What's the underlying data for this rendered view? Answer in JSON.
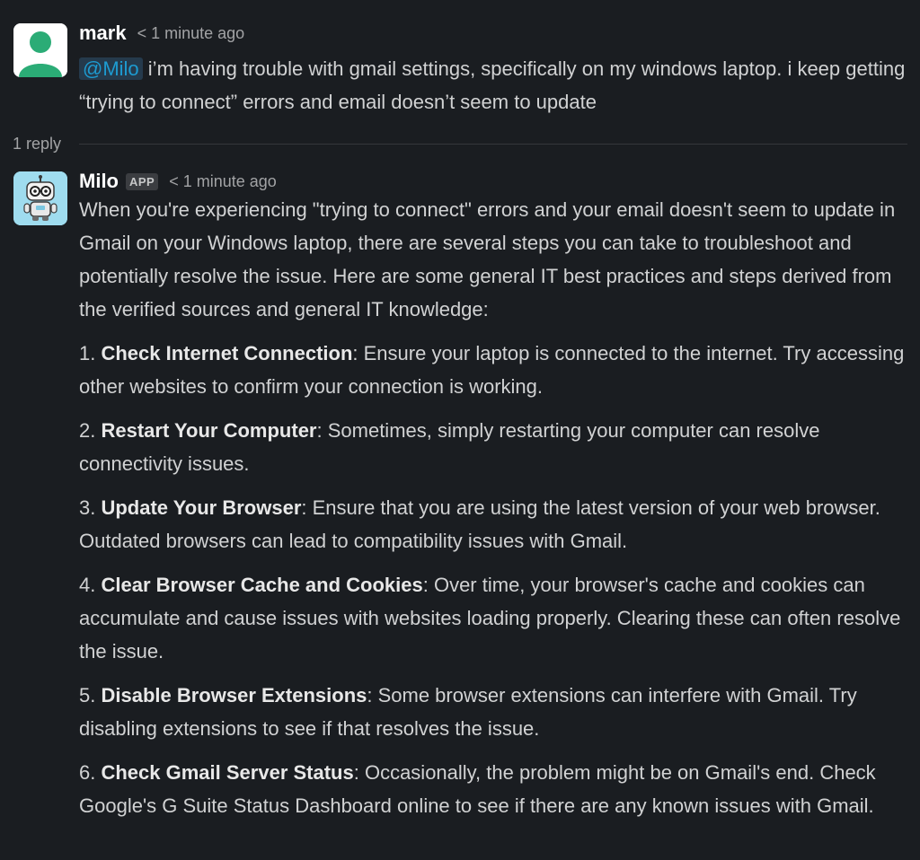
{
  "message1": {
    "author": "mark",
    "timestamp": "< 1 minute ago",
    "mention": "@Milo",
    "text": "i’m having trouble with gmail settings, specifically on my windows laptop. i keep getting “trying to connect” errors and email doesn’t seem to update"
  },
  "thread": {
    "reply_count_label": "1 reply"
  },
  "message2": {
    "author": "Milo",
    "badge": "APP",
    "timestamp": "< 1 minute ago",
    "intro": "When you're experiencing \"trying to connect\" errors and your email doesn't seem to update in Gmail on your Windows laptop, there are several steps you can take to troubleshoot and potentially resolve the issue. Here are some general IT best practices and steps derived from the verified sources and general IT knowledge:",
    "steps": [
      {
        "number": "1.",
        "title": "Check Internet Connection",
        "text": ": Ensure your laptop is connected to the internet. Try accessing other websites to confirm your connection is working."
      },
      {
        "number": "2.",
        "title": "Restart Your Computer",
        "text": ": Sometimes, simply restarting your computer can resolve connectivity issues."
      },
      {
        "number": "3.",
        "title": "Update Your Browser",
        "text": ": Ensure that you are using the latest version of your web browser. Outdated browsers can lead to compatibility issues with Gmail."
      },
      {
        "number": "4.",
        "title": "Clear Browser Cache and Cookies",
        "text": ": Over time, your browser's cache and cookies can accumulate and cause issues with websites loading properly. Clearing these can often resolve the issue."
      },
      {
        "number": "5.",
        "title": "Disable Browser Extensions",
        "text": ": Some browser extensions can interfere with Gmail. Try disabling extensions to see if that resolves the issue."
      },
      {
        "number": "6.",
        "title": "Check Gmail Server Status",
        "text": ": Occasionally, the problem might be on Gmail's end. Check Google's G Suite Status Dashboard online to see if there are any known issues with Gmail."
      }
    ]
  },
  "colors": {
    "background": "#1a1d21",
    "mark_avatar": "#2bac76",
    "milo_avatar": "#9fdcef",
    "mention": "#1d9bd1"
  }
}
